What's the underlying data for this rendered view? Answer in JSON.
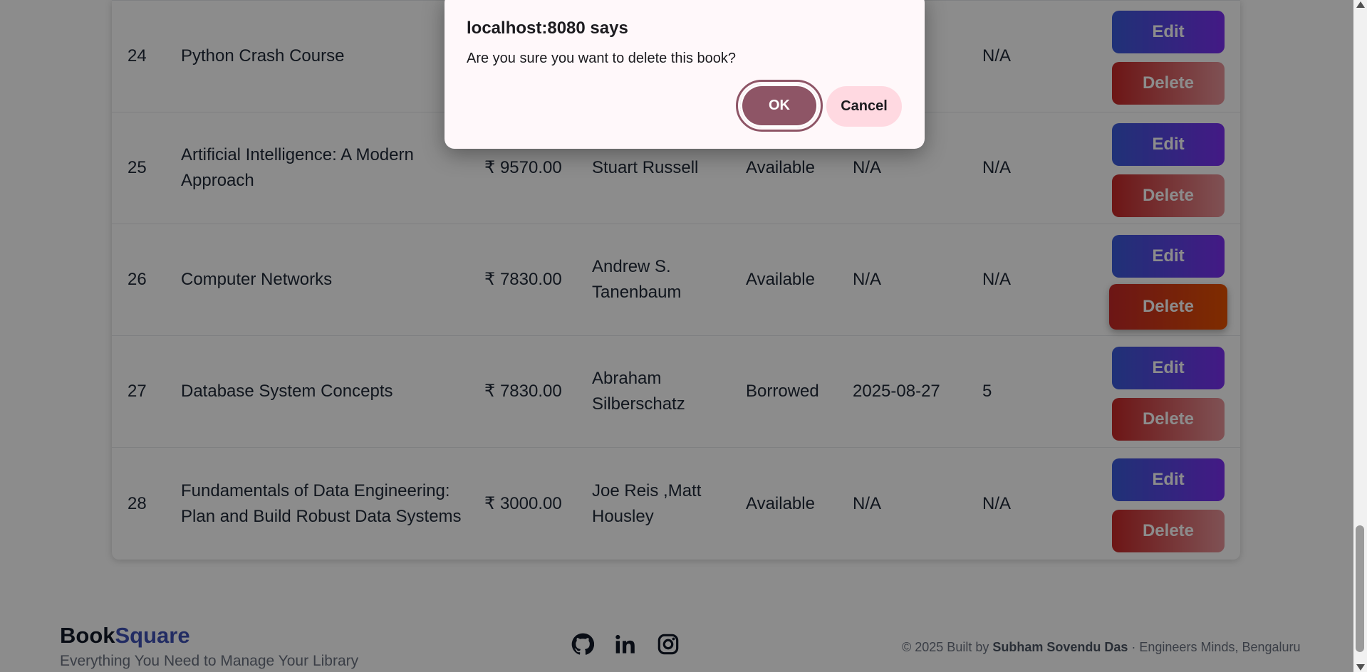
{
  "table": {
    "rows": [
      {
        "id": "24",
        "title": "Python Crash Course",
        "price": "",
        "author": "",
        "status": "",
        "due_date": "",
        "fine": "N/A",
        "edit_label": "Edit",
        "delete_label": "Delete"
      },
      {
        "id": "25",
        "title": "Artificial Intelligence: A Modern Approach",
        "price": "₹ 9570.00",
        "author": "Stuart Russell",
        "status": "Available",
        "due_date": "N/A",
        "fine": "N/A",
        "edit_label": "Edit",
        "delete_label": "Delete"
      },
      {
        "id": "26",
        "title": "Computer Networks",
        "price": "₹ 7830.00",
        "author": "Andrew S. Tanenbaum",
        "status": "Available",
        "due_date": "N/A",
        "fine": "N/A",
        "edit_label": "Edit",
        "delete_label": "Delete"
      },
      {
        "id": "27",
        "title": "Database System Concepts",
        "price": "₹ 7830.00",
        "author": "Abraham Silberschatz",
        "status": "Borrowed",
        "due_date": "2025-08-27",
        "fine": "5",
        "edit_label": "Edit",
        "delete_label": "Delete"
      },
      {
        "id": "28",
        "title": "Fundamentals of Data Engineering: Plan and Build Robust Data Systems",
        "price": "₹ 3000.00",
        "author": "Joe Reis ,Matt Housley",
        "status": "Available",
        "due_date": "N/A",
        "fine": "N/A",
        "edit_label": "Edit",
        "delete_label": "Delete"
      }
    ]
  },
  "footer": {
    "brand_part1": "Book",
    "brand_part2": "Square",
    "tagline": "Everything You Need to Manage Your Library",
    "social_icons": [
      "github-icon",
      "linkedin-icon",
      "instagram-icon"
    ],
    "copyright_prefix": "© 2025 Built by ",
    "copyright_author": "Subham Sovendu Das",
    "copyright_suffix": " · Engineers Minds, Bengaluru"
  },
  "dialog": {
    "title": "localhost:8080 says",
    "message": "Are you sure you want to delete this book?",
    "ok_label": "OK",
    "cancel_label": "Cancel"
  },
  "colors": {
    "edit_gradient": [
      "#3a5bd9",
      "#7b2ff2"
    ],
    "delete_gradient": [
      "#c62828",
      "#e8959a"
    ],
    "brand_accent": "#3f51b5",
    "dialog_ok": "#8e5566",
    "dialog_cancel": "#ffd9e1"
  }
}
